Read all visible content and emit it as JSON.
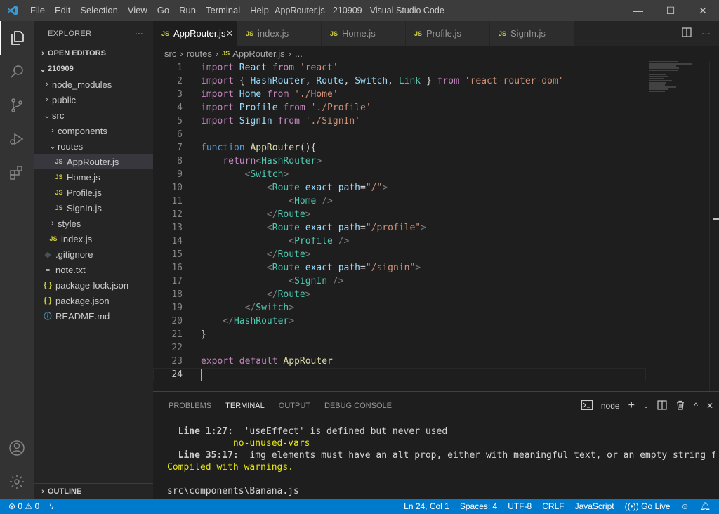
{
  "window": {
    "title": "AppRouter.js - 210909 - Visual Studio Code",
    "menu": [
      "File",
      "Edit",
      "Selection",
      "View",
      "Go",
      "Run",
      "Terminal",
      "Help"
    ],
    "controls": {
      "minimize": "—",
      "maximize": "☐",
      "close": "✕"
    }
  },
  "activity_bar": {
    "items": [
      "explorer",
      "search",
      "source-control",
      "run-debug",
      "extensions"
    ],
    "bottom": [
      "accounts",
      "manage"
    ]
  },
  "sidebar": {
    "header": "EXPLORER",
    "more": "···",
    "open_editors": "OPEN EDITORS",
    "project": "210909",
    "tree": [
      {
        "label": "node_modules",
        "kind": "folder",
        "indent": 1,
        "open": false
      },
      {
        "label": "public",
        "kind": "folder",
        "indent": 1,
        "open": false
      },
      {
        "label": "src",
        "kind": "folder",
        "indent": 1,
        "open": true
      },
      {
        "label": "components",
        "kind": "folder",
        "indent": 2,
        "open": false
      },
      {
        "label": "routes",
        "kind": "folder",
        "indent": 2,
        "open": true
      },
      {
        "label": "AppRouter.js",
        "kind": "js",
        "indent": 3,
        "selected": true
      },
      {
        "label": "Home.js",
        "kind": "js",
        "indent": 3
      },
      {
        "label": "Profile.js",
        "kind": "js",
        "indent": 3
      },
      {
        "label": "SignIn.js",
        "kind": "js",
        "indent": 3
      },
      {
        "label": "styles",
        "kind": "folder",
        "indent": 2,
        "open": false
      },
      {
        "label": "index.js",
        "kind": "js",
        "indent": 2
      },
      {
        "label": ".gitignore",
        "kind": "git",
        "indent": 1
      },
      {
        "label": "note.txt",
        "kind": "txt",
        "indent": 1
      },
      {
        "label": "package-lock.json",
        "kind": "json",
        "indent": 1
      },
      {
        "label": "package.json",
        "kind": "json",
        "indent": 1
      },
      {
        "label": "README.md",
        "kind": "info",
        "indent": 1
      }
    ],
    "outline": "OUTLINE"
  },
  "tabs": [
    {
      "label": "AppRouter.js",
      "active": true,
      "icon": "JS"
    },
    {
      "label": "index.js",
      "icon": "JS"
    },
    {
      "label": "Home.js",
      "icon": "JS"
    },
    {
      "label": "Profile.js",
      "icon": "JS"
    },
    {
      "label": "SignIn.js",
      "icon": "JS"
    }
  ],
  "breadcrumb": [
    "src",
    "routes",
    "AppRouter.js",
    "..."
  ],
  "code": [
    [
      [
        "kw-ctrl",
        "import"
      ],
      [
        "plain",
        " "
      ],
      [
        "var",
        "React"
      ],
      [
        "plain",
        " "
      ],
      [
        "kw-ctrl",
        "from"
      ],
      [
        "plain",
        " "
      ],
      [
        "str",
        "'react'"
      ]
    ],
    [
      [
        "kw-ctrl",
        "import"
      ],
      [
        "plain",
        " { "
      ],
      [
        "var",
        "HashRouter"
      ],
      [
        "plain",
        ", "
      ],
      [
        "var",
        "Route"
      ],
      [
        "plain",
        ", "
      ],
      [
        "var",
        "Switch"
      ],
      [
        "plain",
        ", "
      ],
      [
        "cls",
        "Link"
      ],
      [
        "plain",
        " } "
      ],
      [
        "kw-ctrl",
        "from"
      ],
      [
        "plain",
        " "
      ],
      [
        "str",
        "'react-router-dom'"
      ]
    ],
    [
      [
        "kw-ctrl",
        "import"
      ],
      [
        "plain",
        " "
      ],
      [
        "var",
        "Home"
      ],
      [
        "plain",
        " "
      ],
      [
        "kw-ctrl",
        "from"
      ],
      [
        "plain",
        " "
      ],
      [
        "str",
        "'./Home'"
      ]
    ],
    [
      [
        "kw-ctrl",
        "import"
      ],
      [
        "plain",
        " "
      ],
      [
        "var",
        "Profile"
      ],
      [
        "plain",
        " "
      ],
      [
        "kw-ctrl",
        "from"
      ],
      [
        "plain",
        " "
      ],
      [
        "str",
        "'./Profile'"
      ]
    ],
    [
      [
        "kw-ctrl",
        "import"
      ],
      [
        "plain",
        " "
      ],
      [
        "var",
        "SignIn"
      ],
      [
        "plain",
        " "
      ],
      [
        "kw-ctrl",
        "from"
      ],
      [
        "plain",
        " "
      ],
      [
        "str",
        "'./SignIn'"
      ]
    ],
    [],
    [
      [
        "kw",
        "function"
      ],
      [
        "plain",
        " "
      ],
      [
        "fn",
        "AppRouter"
      ],
      [
        "plain",
        "(){"
      ]
    ],
    [
      [
        "plain",
        "    "
      ],
      [
        "kw-ctrl",
        "return"
      ],
      [
        "brk",
        "<"
      ],
      [
        "tag",
        "HashRouter"
      ],
      [
        "brk",
        ">"
      ]
    ],
    [
      [
        "plain",
        "        "
      ],
      [
        "brk",
        "<"
      ],
      [
        "tag",
        "Switch"
      ],
      [
        "brk",
        ">"
      ]
    ],
    [
      [
        "plain",
        "            "
      ],
      [
        "brk",
        "<"
      ],
      [
        "tag",
        "Route"
      ],
      [
        "plain",
        " "
      ],
      [
        "var",
        "exact"
      ],
      [
        "plain",
        " "
      ],
      [
        "var",
        "path"
      ],
      [
        "plain",
        "="
      ],
      [
        "str",
        "\"/\""
      ],
      [
        "brk",
        ">"
      ]
    ],
    [
      [
        "plain",
        "                "
      ],
      [
        "brk",
        "<"
      ],
      [
        "tag",
        "Home"
      ],
      [
        "plain",
        " "
      ],
      [
        "brk",
        "/>"
      ]
    ],
    [
      [
        "plain",
        "            "
      ],
      [
        "brk",
        "</"
      ],
      [
        "tag",
        "Route"
      ],
      [
        "brk",
        ">"
      ]
    ],
    [
      [
        "plain",
        "            "
      ],
      [
        "brk",
        "<"
      ],
      [
        "tag",
        "Route"
      ],
      [
        "plain",
        " "
      ],
      [
        "var",
        "exact"
      ],
      [
        "plain",
        " "
      ],
      [
        "var",
        "path"
      ],
      [
        "plain",
        "="
      ],
      [
        "str",
        "\"/profile\""
      ],
      [
        "brk",
        ">"
      ]
    ],
    [
      [
        "plain",
        "                "
      ],
      [
        "brk",
        "<"
      ],
      [
        "tag",
        "Profile"
      ],
      [
        "plain",
        " "
      ],
      [
        "brk",
        "/>"
      ]
    ],
    [
      [
        "plain",
        "            "
      ],
      [
        "brk",
        "</"
      ],
      [
        "tag",
        "Route"
      ],
      [
        "brk",
        ">"
      ]
    ],
    [
      [
        "plain",
        "            "
      ],
      [
        "brk",
        "<"
      ],
      [
        "tag",
        "Route"
      ],
      [
        "plain",
        " "
      ],
      [
        "var",
        "exact"
      ],
      [
        "plain",
        " "
      ],
      [
        "var",
        "path"
      ],
      [
        "plain",
        "="
      ],
      [
        "str",
        "\"/signin\""
      ],
      [
        "brk",
        ">"
      ]
    ],
    [
      [
        "plain",
        "                "
      ],
      [
        "brk",
        "<"
      ],
      [
        "tag",
        "SignIn"
      ],
      [
        "plain",
        " "
      ],
      [
        "brk",
        "/>"
      ]
    ],
    [
      [
        "plain",
        "            "
      ],
      [
        "brk",
        "</"
      ],
      [
        "tag",
        "Route"
      ],
      [
        "brk",
        ">"
      ]
    ],
    [
      [
        "plain",
        "        "
      ],
      [
        "brk",
        "</"
      ],
      [
        "tag",
        "Switch"
      ],
      [
        "brk",
        ">"
      ]
    ],
    [
      [
        "plain",
        "    "
      ],
      [
        "brk",
        "</"
      ],
      [
        "tag",
        "HashRouter"
      ],
      [
        "brk",
        ">"
      ]
    ],
    [
      [
        "plain",
        "}"
      ]
    ],
    [],
    [
      [
        "kw-ctrl",
        "export"
      ],
      [
        "plain",
        " "
      ],
      [
        "kw-ctrl",
        "default"
      ],
      [
        "plain",
        " "
      ],
      [
        "fn",
        "AppRouter"
      ]
    ],
    []
  ],
  "current_line": 24,
  "panel": {
    "tabs": [
      "PROBLEMS",
      "TERMINAL",
      "OUTPUT",
      "DEBUG CONSOLE"
    ],
    "active_tab": "TERMINAL",
    "terminal_name": "node",
    "lines": [
      [
        [
          "t-bold",
          "  Line 1:27:"
        ],
        [
          "plain",
          "  'useEffect' is defined but never used"
        ]
      ],
      [
        [
          "plain",
          "            "
        ],
        [
          "t-yellow t-under",
          "no-unused-vars"
        ]
      ],
      [
        [
          "t-bold",
          "  Line 35:17:"
        ],
        [
          "plain",
          "  img elements must have an alt prop, either with meaningful text, or an empty string for decora"
        ]
      ],
      [
        [
          "t-yellow",
          "Compiled with warnings."
        ]
      ],
      [
        [
          "plain",
          ""
        ]
      ],
      [
        [
          "plain",
          "src\\components\\Banana.js"
        ]
      ]
    ]
  },
  "status": {
    "errors": "0",
    "warnings": "0",
    "position": "Ln 24, Col 1",
    "spaces": "Spaces: 4",
    "encoding": "UTF-8",
    "eol": "CRLF",
    "language": "JavaScript",
    "golive": "Go Live"
  }
}
